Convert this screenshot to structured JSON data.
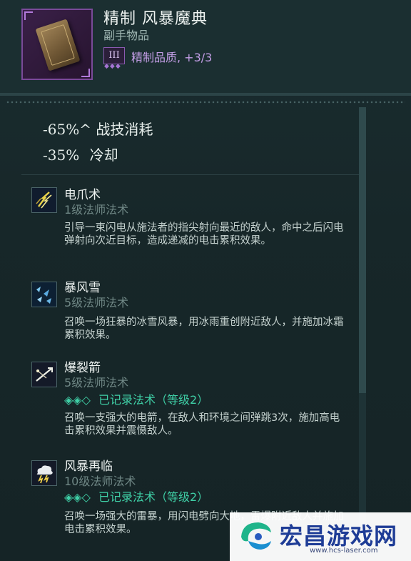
{
  "item": {
    "name": "精制 风暴魔典",
    "type": "副手物品",
    "quality_badge": "III",
    "quality_dots": "◆◆◆",
    "quality_text": "精制品质, +3/3"
  },
  "stats": [
    {
      "value": "-65%",
      "suffix": "^",
      "label": "战技消耗"
    },
    {
      "value": "-35%",
      "suffix": "",
      "label": "冷却"
    }
  ],
  "skills": [
    {
      "name": "电爪术",
      "level": "1级法师法术",
      "description": "引导一束闪电从施法者的指尖射向最近的敌人，命中之后闪电弹射向次近目标，造成递减的电击累积效果。",
      "icon": "lightning-claw-icon"
    },
    {
      "name": "暴风雪",
      "level": "5级法师法术",
      "description": "召唤一场狂暴的冰雪风暴，用冰雨重创附近敌人，并施加冰霜累积效果。",
      "icon": "blizzard-icon"
    },
    {
      "name": "爆裂箭",
      "level": "5级法师法术",
      "recorded": "已记录法术（等级2）",
      "recorded_marks": "◈◈◇",
      "description": "召唤一支强大的电箭，在敌人和环境之间弹跳3次，施加高电击累积效果并震慑敌人。",
      "icon": "burst-arrow-icon"
    },
    {
      "name": "风暴再临",
      "level": "10级法师法术",
      "recorded": "已记录法术（等级2）",
      "recorded_marks": "◈◈◇",
      "description": "召唤一场强大的雷暴，用闪电劈向大地，雷爆附近敌人并施加电击累积效果。",
      "icon": "storm-cloud-icon"
    }
  ],
  "watermark": {
    "title": "宏昌游戏网",
    "url": "www.hcs-laser.com"
  },
  "colors": {
    "background": "#162628",
    "quality_purple": "#c39ee6",
    "recorded_green": "#3fcfa6",
    "muted_text": "#6f8785"
  }
}
